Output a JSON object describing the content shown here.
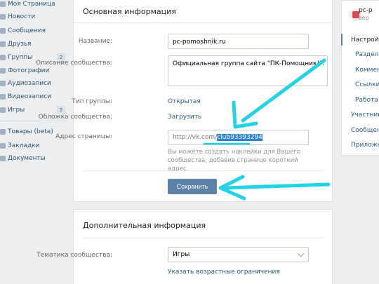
{
  "nav": {
    "items": [
      {
        "label": "Моя Страница",
        "badge": ""
      },
      {
        "label": "Новости",
        "badge": ""
      },
      {
        "label": "Сообщения",
        "badge": ""
      },
      {
        "label": "Друзья",
        "badge": ""
      },
      {
        "label": "Группы",
        "badge": "2"
      },
      {
        "label": "Фотографии",
        "badge": ""
      },
      {
        "label": "Аудиозаписи",
        "badge": ""
      },
      {
        "label": "Видеозаписи",
        "badge": ""
      },
      {
        "label": "Игры",
        "badge": "2"
      }
    ],
    "secondary": [
      "Товары (beta)",
      "Закладки",
      "Документы"
    ]
  },
  "main": {
    "title": "Основная информация",
    "name_label": "Название:",
    "name_value": "pc-pomoshnik.ru",
    "desc_label": "Описание сообщества:",
    "desc_value": "Официальная группа сайта \"ПК-Помощник!\".",
    "type_label": "Тип группы:",
    "type_value": "Открытая",
    "cover_label": "Обложка сообщества:",
    "cover_value": "Загрузить",
    "address_label": "Адрес страницы:",
    "address_prefix": "http://vk.com/",
    "address_value": "club93393294",
    "address_hint": "Вы можете создать наклейки для Вашего сообщества, добавив странице короткий адрес.",
    "save_label": "Сохранить"
  },
  "extra": {
    "title": "Дополнительная информация",
    "theme_label": "Тематика сообщества:",
    "theme_value": "Игры",
    "age_link": "Указать возрастные ограничения"
  },
  "right": {
    "group_name": "pc-p",
    "group_sub": "вер",
    "menu": [
      "Настройк",
      "Раздель",
      "Коммент",
      "Ссылки",
      "Работа с",
      "Участник",
      "Сообщен",
      "Приложен"
    ]
  },
  "colors": {
    "accent": "#5e81a8",
    "link": "#2a5885",
    "arrow": "#22d3e6",
    "selection": "#2a83d7"
  }
}
